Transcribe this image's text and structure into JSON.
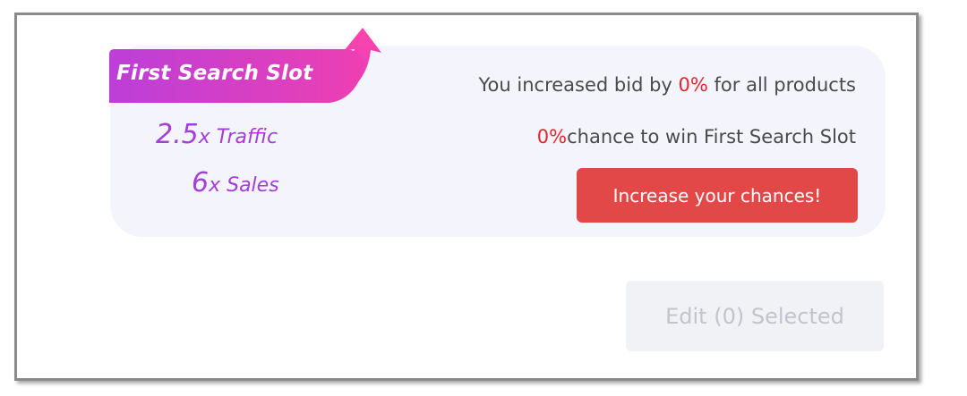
{
  "promo": {
    "ribbon_label": "First Search Slot",
    "benefits": {
      "traffic_multiplier": "2.5",
      "traffic_unit": "x Traffic",
      "sales_multiplier": "6",
      "sales_unit": "x Sales"
    },
    "bid_message": {
      "prefix": "You increased bid by ",
      "percent": "0%",
      "suffix": " for all products"
    },
    "chance_message": {
      "percent": "0%",
      "suffix": "chance to win First Search Slot"
    },
    "cta_label": "Increase your chances!"
  },
  "actions": {
    "edit_label": "Edit (0) Selected",
    "edit_enabled": false
  },
  "colors": {
    "ribbon_start": "#c23ed6",
    "ribbon_end": "#f03fb0",
    "benefit_text": "#a33fd6",
    "percent_red": "#e8232b",
    "cta_bg": "#e34848",
    "card_bg": "#f3f4fc"
  }
}
